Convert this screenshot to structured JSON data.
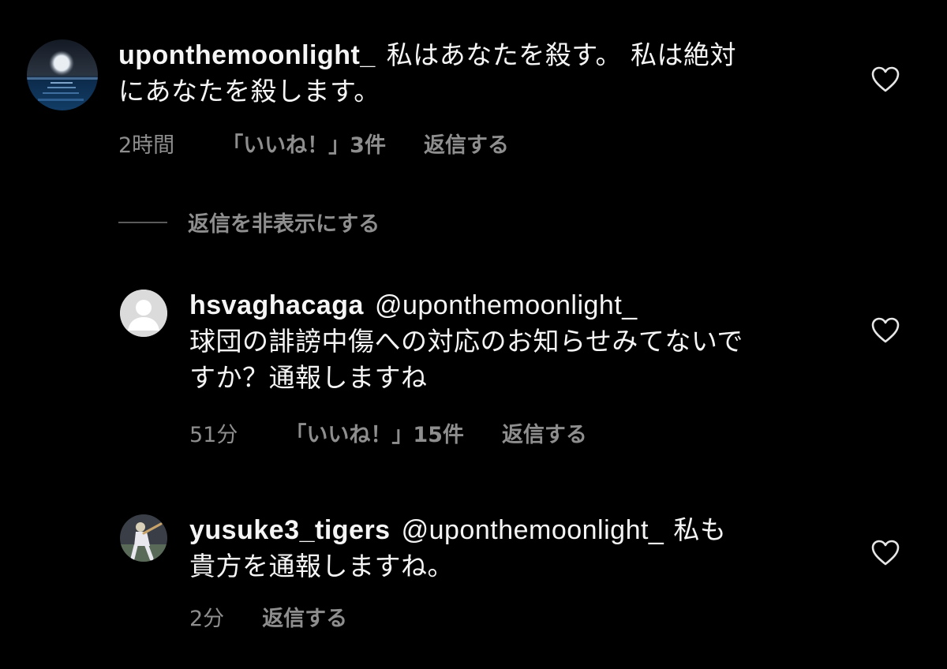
{
  "comments": [
    {
      "username": "uponthemoonlight_",
      "text_line1": "私はあなたを殺す。 私は絶対",
      "text_line2": "にあなたを殺します。",
      "time": "2時間",
      "likes": "「いいね！」3件",
      "reply": "返信する"
    },
    {
      "username": "hsvaghacaga",
      "mention": "@uponthemoonlight_",
      "text_line2": "球団の誹謗中傷への対応のお知らせみてないで",
      "text_line3": "すか？通報しますね",
      "time": "51分",
      "likes": "「いいね！」15件",
      "reply": "返信する"
    },
    {
      "username": "yusuke3_tigers",
      "mention": "@uponthemoonlight_",
      "text_line1_tail": "私も",
      "text_line2": "貴方を通報しますね。",
      "time": "2分",
      "reply": "返信する"
    }
  ],
  "hide_replies": "返信を非表示にする",
  "icons": {
    "like": "heart-outline-icon",
    "default_avatar": "default-avatar-icon"
  },
  "colors": {
    "background": "#000000",
    "text": "#f5f5f5",
    "secondary": "#8e8e8e"
  }
}
